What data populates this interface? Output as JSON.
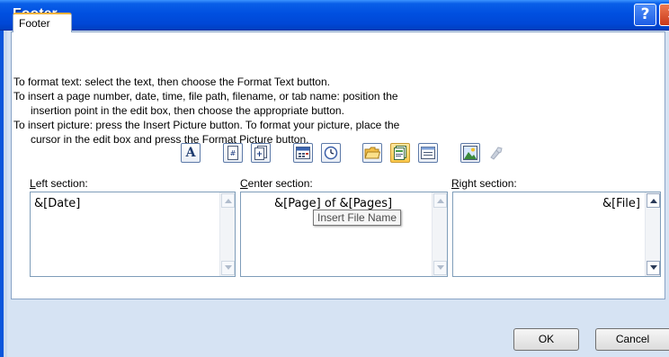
{
  "window": {
    "title": "Footer"
  },
  "tab": {
    "label": "Footer"
  },
  "instructions": [
    "To format text:  select the text, then choose the Format Text button.",
    "To insert a page number, date, time, file path, filename, or tab name:  position the",
    "insertion point in the edit box, then choose the appropriate button.",
    "To insert picture: press the Insert Picture button.  To format your picture, place the",
    "cursor in the edit box and press the Format Picture button."
  ],
  "toolbar": {
    "format_text": "A",
    "insert_page_number": "#",
    "insert_number_of_pages": "+"
  },
  "sections": {
    "left": {
      "label": "Left section:",
      "accel": "L",
      "rest": "eft section:",
      "value": "&[Date]"
    },
    "center": {
      "label": "Center section:",
      "accel": "C",
      "rest": "enter section:",
      "value": "&[Page] of &[Pages]"
    },
    "right": {
      "label": "Right section:",
      "accel": "R",
      "rest": "ight section:",
      "value": "&[File]"
    }
  },
  "tooltip": {
    "text": "Insert File Name"
  },
  "buttons": {
    "ok": "OK",
    "cancel": "Cancel"
  },
  "icons": {
    "help": "help-icon",
    "close": "close-icon"
  },
  "colors": {
    "titlebar": "#0050e0",
    "client_bg": "#d6e3f3",
    "border": "#8aa4c6"
  }
}
